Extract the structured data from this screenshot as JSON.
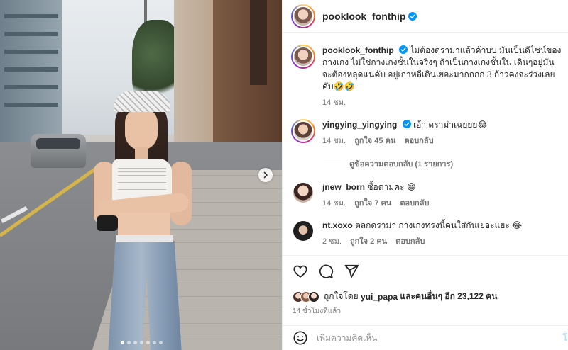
{
  "post": {
    "username": "pooklook_fonthip",
    "photo": {
      "carousel_dots": 7,
      "active_dot": 0
    }
  },
  "comments": [
    {
      "username": "pooklook_fonthip",
      "verified": true,
      "text": "ไม่ต้องดราม่าแล้วค้าบบ มันเป็นดีไซน์ของกางเกง ไม่ใช่กางเกงชั้นในจริงๆ ถ้าเป็นกางเกงชั้นใน เดินๆอยู่มันจะต้องหลุดแน่คับ อยู่เกาหลีเดินเยอะมากกกก 3 ก้าวคงจะร่วงเลยคับ🤣🤣",
      "time": "14 ชม."
    },
    {
      "username": "yingying_yingying",
      "verified": true,
      "text": "เอ้า ดราม่าเฉยยย😂",
      "time": "14 ชม.",
      "likes": "ถูกใจ 45 คน",
      "reply": "ตอบกลับ",
      "view_replies": "ดูข้อความตอบกลับ (1 รายการ)"
    },
    {
      "username": "jnew_born",
      "verified": false,
      "text": "ซื้อตามคะ 😄",
      "time": "14 ชม.",
      "likes": "ถูกใจ 7 คน",
      "reply": "ตอบกลับ"
    },
    {
      "username": "nt.xoxo",
      "verified": false,
      "text": "ตลกดราม่า กางเกงทรงนี้คนใส่กันเยอะแยะ 😂",
      "time": "2 ชม.",
      "likes": "ถูกใจ 2 คน",
      "reply": "ตอบกลับ"
    }
  ],
  "actions": {
    "icons": [
      "heart-icon",
      "comment-icon",
      "share-icon"
    ],
    "liked_by_prefix": "ถูกใจโดย",
    "liked_by_user": "yui_papa",
    "liked_by_suffix": "และคนอื่นๆ อีก 23,122 คน",
    "posted_ago": "14 ชั่วโมงที่แล้ว"
  },
  "add_comment": {
    "placeholder": "เพิ่มความคิดเห็น",
    "post_label": "โ"
  },
  "colors": {
    "verified": "#0095f6",
    "muted": "#737373",
    "text": "#262626"
  }
}
